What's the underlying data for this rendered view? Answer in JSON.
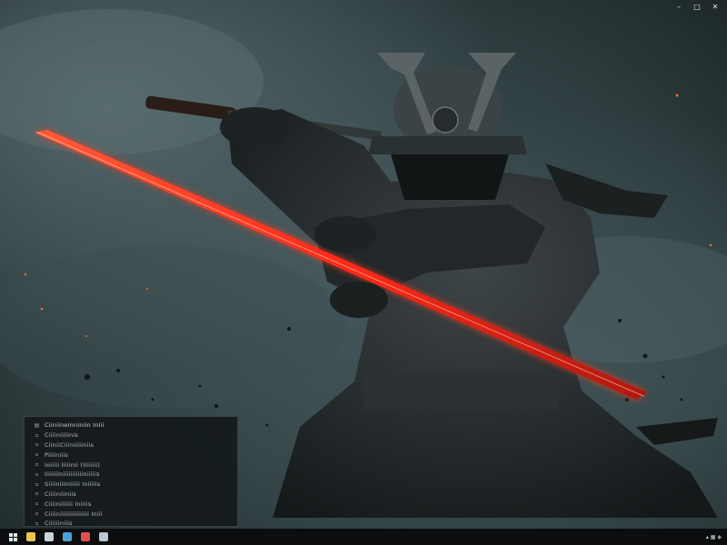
{
  "window_controls": {
    "minimize_glyph": "–",
    "maximize_glyph": "□",
    "close_glyph": "✕"
  },
  "start_panel": {
    "rows": [
      {
        "icon": "folder-icon",
        "glyph": "▤",
        "label": "Ciiniineinniniin Iniii"
      },
      {
        "icon": "file-icon",
        "glyph": "▫",
        "label": "Ciiiiniiiiinis"
      },
      {
        "icon": "file-icon",
        "glyph": "▫",
        "label": "CiiniiCiiiniiiiiniis"
      },
      {
        "icon": "file-icon",
        "glyph": "▫",
        "label": "Piiiiniiis"
      },
      {
        "icon": "file-icon",
        "glyph": "▫",
        "label": "Ioiiiii Iiiiinii (Iiiiiiii)"
      },
      {
        "icon": "file-icon",
        "glyph": "▫",
        "label": "Iiiiiiiiniiiiiiiiiiiniiiiis"
      },
      {
        "icon": "file-icon",
        "glyph": "▫",
        "label": "Siiiiniiiniiiiii Iniiiiis"
      },
      {
        "icon": "file-icon",
        "glyph": "▫",
        "label": "Ciiiiniiiniis"
      },
      {
        "icon": "file-icon",
        "glyph": "▫",
        "label": "Ciiiiniiiiiii Iniiiis"
      },
      {
        "icon": "file-icon",
        "glyph": "▫",
        "label": "Ciiiiniiiiiiiiiiiiiiii  Iniii"
      },
      {
        "icon": "file-icon",
        "glyph": "▫",
        "label": "Ciiiiiiniiis"
      },
      {
        "icon": "file-icon",
        "glyph": "▫",
        "label": "Iiiiiiiiii Ciiiiiiiiiniiiiiiiniiii iniiiiii  Iniiiii iiniiiiiiii Iniii"
      }
    ]
  },
  "taskbar": {
    "apps": [
      {
        "name": "file-explorer-icon",
        "color": "#e8c450"
      },
      {
        "name": "camera-app-icon",
        "color": "#c9d4da"
      },
      {
        "name": "browser-icon",
        "color": "#4aa3d8"
      },
      {
        "name": "mail-app-icon",
        "color": "#e25050"
      },
      {
        "name": "media-app-icon",
        "color": "#b9c7d0"
      }
    ],
    "tray_text": "▴  ▦  ◈"
  },
  "colors": {
    "sword_glow": "#ff3b1f",
    "panel_bg": "#141a1c",
    "taskbar_bg": "#0b0d0e"
  }
}
